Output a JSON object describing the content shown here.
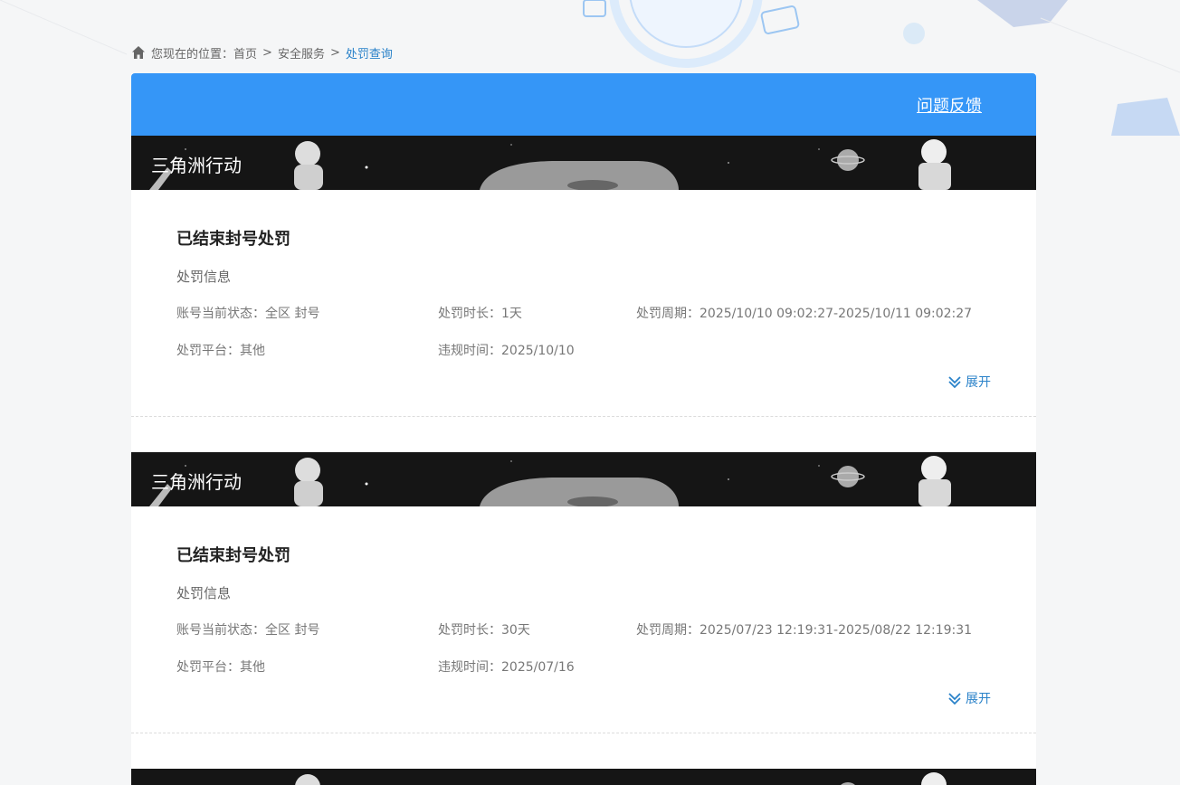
{
  "breadcrumb": {
    "prefix": "您现在的位置：",
    "items": [
      "首页",
      "安全服务",
      "处罚查询"
    ],
    "separator": ">"
  },
  "header": {
    "feedback_label": "问题反馈"
  },
  "records": [
    {
      "game": "三角洲行动",
      "title": "已结束封号处罚",
      "section_label": "处罚信息",
      "status_label": "账号当前状态：",
      "status_value": "全区 封号",
      "duration_label": "处罚时长：",
      "duration_value": "1天",
      "period_label": "处罚周期：",
      "period_value": "2025/10/10 09:02:27-2025/10/11 09:02:27",
      "platform_label": "处罚平台：",
      "platform_value": "其他",
      "violation_label": "违规时间：",
      "violation_value": "2025/10/10",
      "expand_label": "展开"
    },
    {
      "game": "三角洲行动",
      "title": "已结束封号处罚",
      "section_label": "处罚信息",
      "status_label": "账号当前状态：",
      "status_value": "全区 封号",
      "duration_label": "处罚时长：",
      "duration_value": "30天",
      "period_label": "处罚周期：",
      "period_value": "2025/07/23 12:19:31-2025/08/22 12:19:31",
      "platform_label": "处罚平台：",
      "platform_value": "其他",
      "violation_label": "违规时间：",
      "violation_value": "2025/07/16",
      "expand_label": "展开"
    }
  ],
  "colors": {
    "header": "#3596f7",
    "link": "#2a82c9",
    "banner": "#151515"
  }
}
